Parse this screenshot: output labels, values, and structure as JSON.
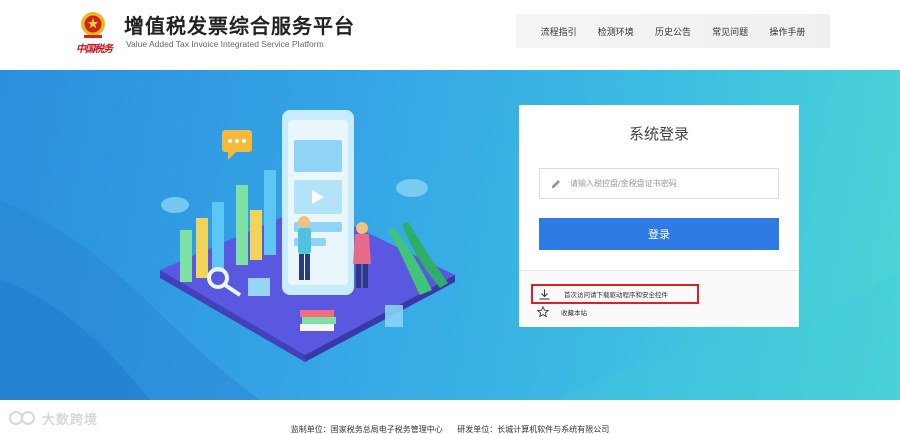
{
  "header": {
    "seal_text": "中国税务",
    "title": "增值税发票综合服务平台",
    "subtitle": "Value Added Tax Invoice Integrated Service Platform",
    "nav": [
      {
        "label": "流程指引"
      },
      {
        "label": "检测环境"
      },
      {
        "label": "历史公告"
      },
      {
        "label": "常见问题"
      },
      {
        "label": "操作手册"
      }
    ]
  },
  "login": {
    "title": "系统登录",
    "account_placeholder": "请输入税控盘/金税盘证书密码",
    "button_label": "登录",
    "download_label": "首次访问请下载驱动程序和安全控件",
    "bookmark_label": "收藏本站"
  },
  "footer": {
    "supervisor": "监制单位：国家税务总局电子税务管理中心",
    "developer": "研发单位：长城计算机软件与系统有限公司"
  },
  "watermark": {
    "text": "大数跨境"
  },
  "colors": {
    "accent": "#2f7be6",
    "hero_start": "#2b8fdd",
    "hero_end": "#4dd6d6",
    "highlight_box": "#e02020",
    "seal_red": "#c8161d"
  }
}
